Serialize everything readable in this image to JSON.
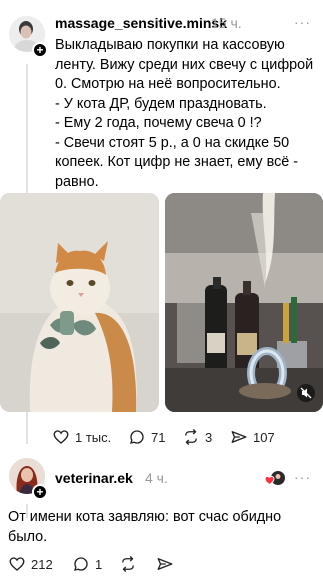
{
  "post": {
    "username": "massage_sensitive.minsk",
    "time": "15 ч.",
    "more": "···",
    "text": "Выкладываю покупки на кассовую ленту. Вижу среди них свечу с цифрой 0. Смотрю на неё вопросительно.\n- У кота ДР,  будем праздновать.\n- Ему 2 года, почему свеча 0 !?\n- Свечи стоят 5 р., а 0 на скидке 50 копеек. Кот цифр не знает, ему всё - равно.",
    "actions": {
      "likes": "1 тыс.",
      "comments": "71",
      "reposts": "3",
      "shares": "107"
    }
  },
  "reply": {
    "username": "veterinar.ek",
    "time": "4 ч.",
    "more": "···",
    "text": "От имени кота заявляю: вот счас обидно было.",
    "actions": {
      "likes": "212",
      "comments": "1"
    }
  },
  "colors": {
    "text": "#000000",
    "muted": "#999999",
    "line": "#e3e3e3"
  },
  "icons": [
    "plus-icon",
    "heart-icon",
    "comment-icon",
    "repost-icon",
    "share-icon",
    "mute-icon",
    "more-icon"
  ]
}
